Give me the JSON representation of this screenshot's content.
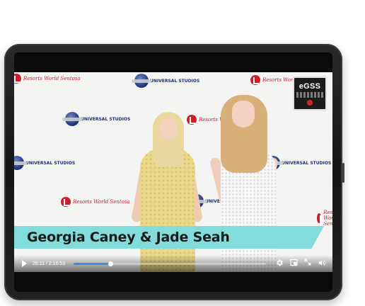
{
  "video": {
    "caption": "Georgia Caney & Jade Seah",
    "badge": {
      "title": "eGSS"
    },
    "backdrop_logos": [
      {
        "kind": "universal-studios",
        "text": "UNIVERSAL STUDIOS"
      },
      {
        "kind": "resorts-world",
        "text": "Resorts World Sentosa"
      }
    ]
  },
  "player": {
    "current_time": "26:11",
    "separator": " / ",
    "duration": "2:16:53",
    "progress_fraction": 0.191,
    "buttons": {
      "play": "play-icon",
      "settings": "gear-icon",
      "miniplayer": "miniplayer-icon",
      "fullscreen": "fullscreen-icon",
      "volume": "volume-icon"
    }
  },
  "colors": {
    "caption_bg": "#82dcdc",
    "progress": "#3b8fe0",
    "frame": "#1a1a1a"
  }
}
